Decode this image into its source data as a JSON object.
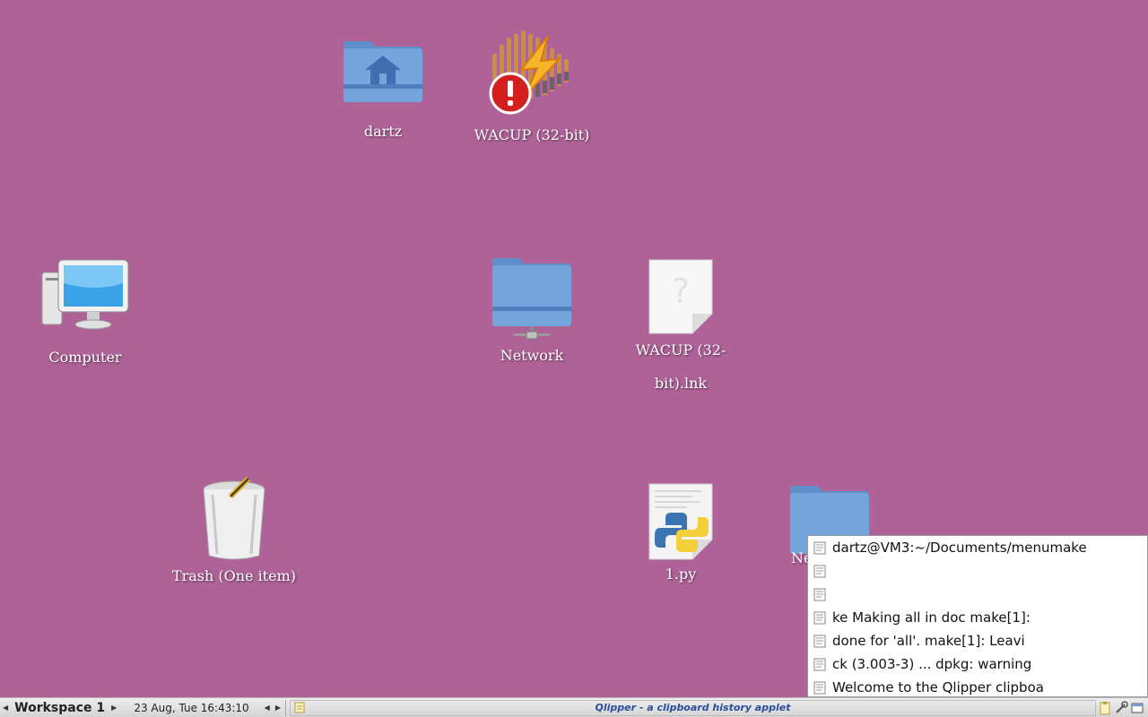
{
  "desktop": {
    "icons": [
      {
        "id": "home",
        "label": "dartz"
      },
      {
        "id": "wacup",
        "label": "WACUP (32-bit)"
      },
      {
        "id": "computer",
        "label": "Computer"
      },
      {
        "id": "network",
        "label": "Network"
      },
      {
        "id": "wacup_lnk",
        "label_line1": "WACUP (32-",
        "label_line2": "bit).lnk"
      },
      {
        "id": "trash",
        "label": "Trash (One item)"
      },
      {
        "id": "py",
        "label": "1.py"
      },
      {
        "id": "newfolder",
        "label": "Ne"
      }
    ]
  },
  "qlipper_menu": {
    "items": [
      "dartz@VM3:~/Documents/menumake",
      "",
      "",
      "ke Making all in doc make[1]:",
      "done for 'all'. make[1]: Leavi",
      "ck (3.003-3) ... dpkg: warning",
      "Welcome to the Qlipper clipboa"
    ]
  },
  "taskbar": {
    "workspace": "Workspace 1",
    "clock": "23 Aug, Tue 16:43:10",
    "active_task": "Qlipper - a clipboard history applet"
  },
  "colors": {
    "desktop_bg": "#ae6297",
    "folder_blue": "#6f9fd8",
    "task_title": "#2b4f9b"
  },
  "icon_names": [
    "home-folder-icon",
    "wacup-app-icon",
    "computer-icon",
    "network-folder-icon",
    "unknown-file-icon",
    "trash-icon",
    "python-file-icon",
    "folder-icon",
    "clipboard-item-icon"
  ]
}
